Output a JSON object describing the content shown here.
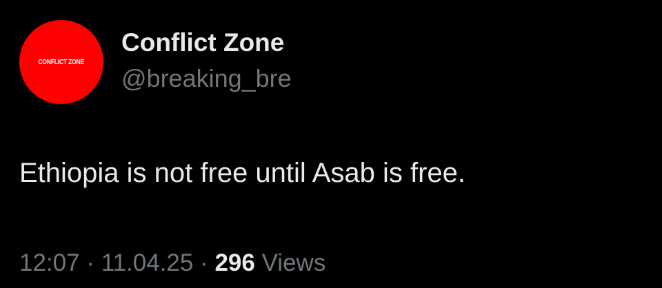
{
  "author": {
    "avatar_text": "CONFLICT ZONE",
    "display_name": "Conflict Zone",
    "handle": "@breaking_bre"
  },
  "post": {
    "text": "Ethiopia is not free until Asab is free.",
    "time": "12:07",
    "separator": " · ",
    "date": "11.04.25",
    "views_count": "296",
    "views_label": " Views"
  },
  "colors": {
    "background": "#000000",
    "primary_text": "#e7e9ea",
    "secondary_text": "#71767b",
    "avatar_bg": "#ff0000"
  }
}
